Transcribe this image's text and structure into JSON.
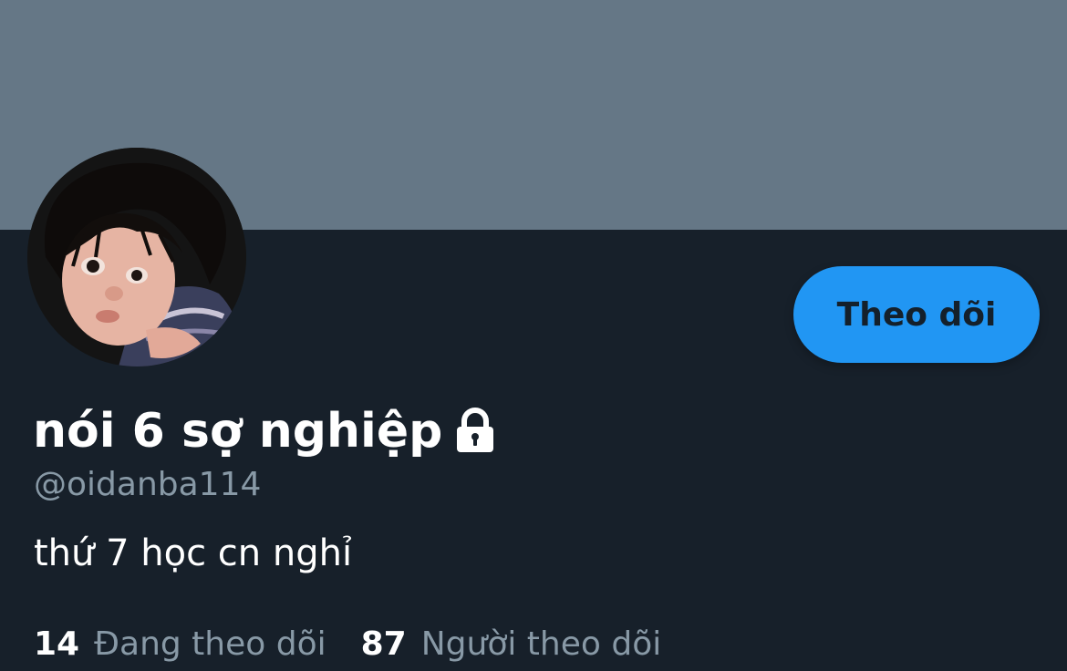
{
  "profile": {
    "display_name": "nói 6 sợ nghiệp",
    "handle": "@oidanba114",
    "bio": "thứ 7 học cn nghỉ",
    "protected_icon": "lock-icon",
    "follow_button_label": "Theo dõi",
    "stats": {
      "following_count": "14",
      "following_label": "Đang theo dõi",
      "followers_count": "87",
      "followers_label": "Người theo dõi"
    }
  },
  "colors": {
    "banner": "#657786",
    "background": "#17202a",
    "accent": "#2196f3",
    "secondary_text": "#8899a6",
    "primary_text": "#ffffff"
  }
}
